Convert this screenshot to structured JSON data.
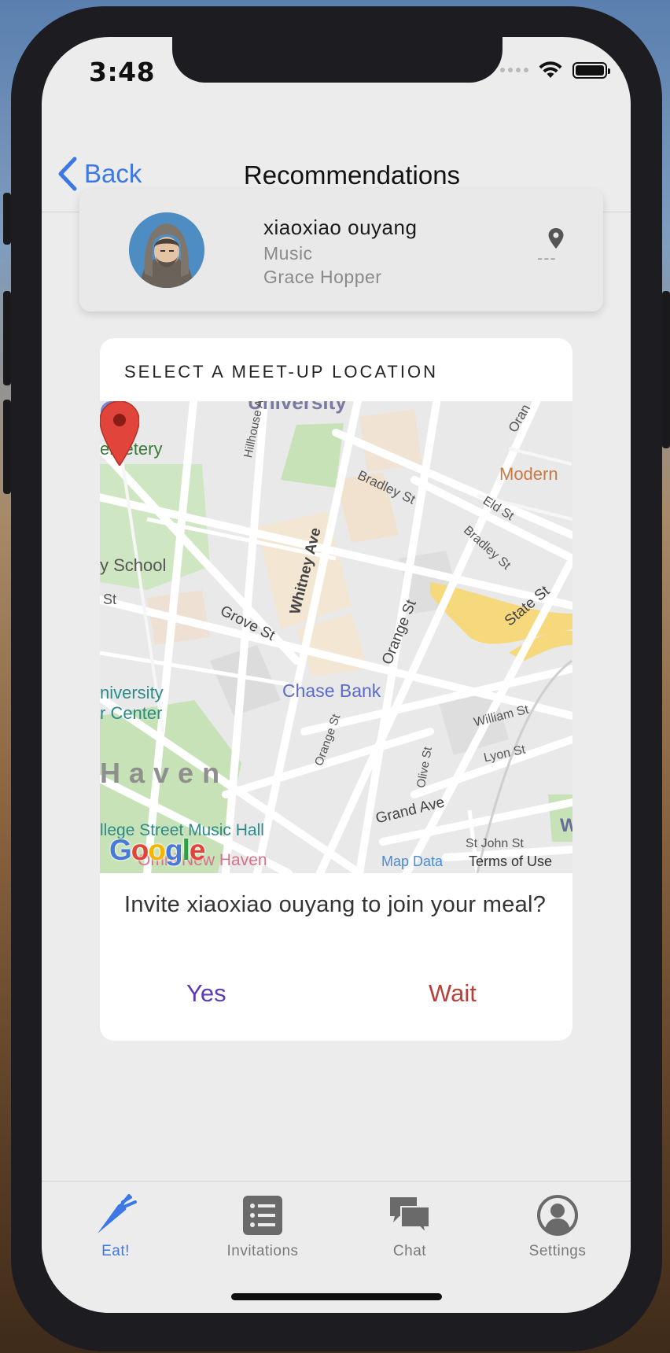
{
  "status_bar": {
    "time": "3:48"
  },
  "navbar": {
    "back_label": "Back",
    "title": "Recommendations"
  },
  "profile": {
    "name": "xiaoxiao ouyang",
    "major": "Music",
    "school": "Grace Hopper",
    "distance": "---"
  },
  "modal": {
    "title": "SELECT A MEET-UP LOCATION",
    "map": {
      "labels": {
        "university": "University",
        "cemetery": "emetery",
        "hillhouse_ave": "Hillhouse Ave",
        "bradley_st_1": "Bradley St",
        "bradley_st_2": "Bradley St",
        "eld_st": "Eld St",
        "modern": "Modern",
        "whitney_ave": "Whitney Ave",
        "school": "y School",
        "grove_st": "Grove St",
        "orange_st_1": "Orange St",
        "orange_st_2": "Orange St",
        "state_st": "State St",
        "chase_bank": "Chase Bank",
        "university_center_1": "niversity",
        "university_center_2": "r Center",
        "haven": "Haven",
        "william_st": "William St",
        "lyon_st": "Lyon St",
        "olive_st": "Olive St",
        "grand_ave": "Grand Ave",
        "st_john_st": "St John St",
        "college_street": "llege Street Music Hall",
        "omni": "Omni New Haven",
        "st_top": "St",
        "st_left": "St",
        "oran": "Oran",
        "w_right": "W"
      },
      "logo": "Google",
      "map_data_link": "Map Data",
      "terms_link": "Terms of Use"
    },
    "invite_text": "Invite xiaoxiao ouyang to join your meal?",
    "yes_label": "Yes",
    "wait_label": "Wait"
  },
  "tabs": [
    {
      "label": "Eat!",
      "icon": "carrot-icon",
      "active": true
    },
    {
      "label": "Invitations",
      "icon": "list-icon",
      "active": false
    },
    {
      "label": "Chat",
      "icon": "chat-bubbles-icon",
      "active": false
    },
    {
      "label": "Settings",
      "icon": "user-circle-icon",
      "active": false
    }
  ],
  "colors": {
    "accent_blue": "#3b78e6",
    "yes_purple": "#5a3cb8",
    "wait_red": "#b8403a",
    "tab_inactive": "#7a7a7a"
  }
}
